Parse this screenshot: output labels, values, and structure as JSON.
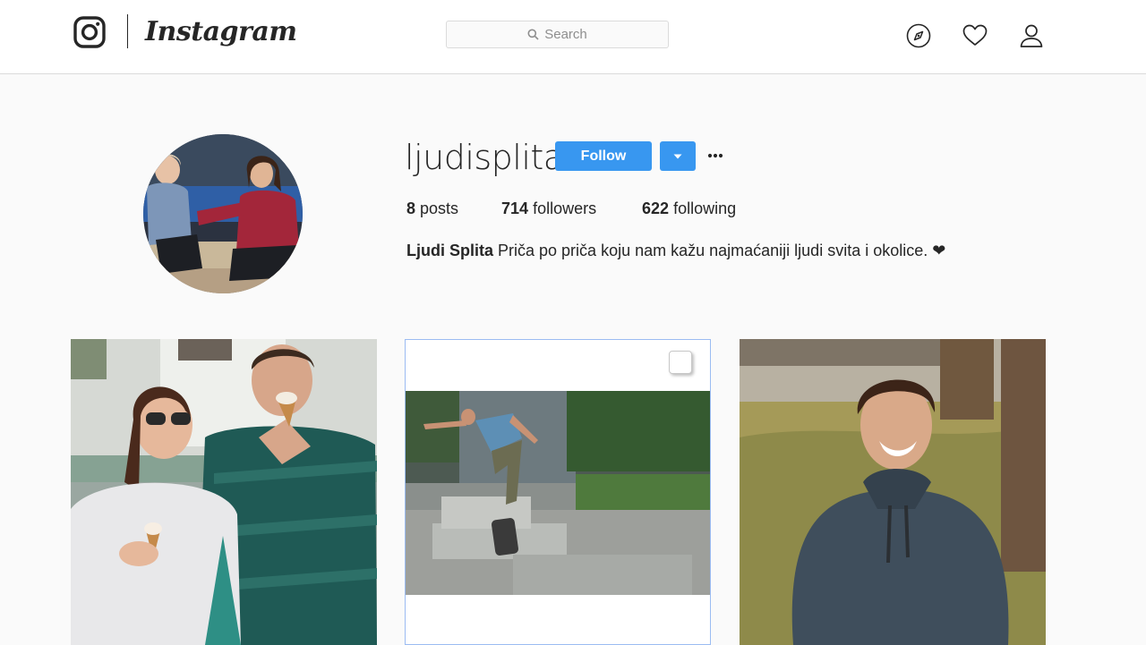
{
  "header": {
    "wordmark": "Instagram",
    "search_placeholder": "Search",
    "icons": [
      "instagram-glyph-icon",
      "compass-icon",
      "heart-icon",
      "person-icon",
      "search-icon"
    ]
  },
  "profile": {
    "username": "ljudisplita",
    "follow_label": "Follow",
    "stats": {
      "posts_count": "8",
      "posts_label": "posts",
      "followers_count": "714",
      "followers_label": "followers",
      "following_count": "622",
      "following_label": "following"
    },
    "bio_name": "Ljudi Splita",
    "bio_text": "Priča po priča koju nam kažu najmaćaniji ljudi svita i okolice. ❤"
  },
  "colors": {
    "accent": "#3897f0",
    "border": "#dbdbdb",
    "background": "#fafafa",
    "text": "#262626",
    "muted": "#8e8e8e"
  }
}
